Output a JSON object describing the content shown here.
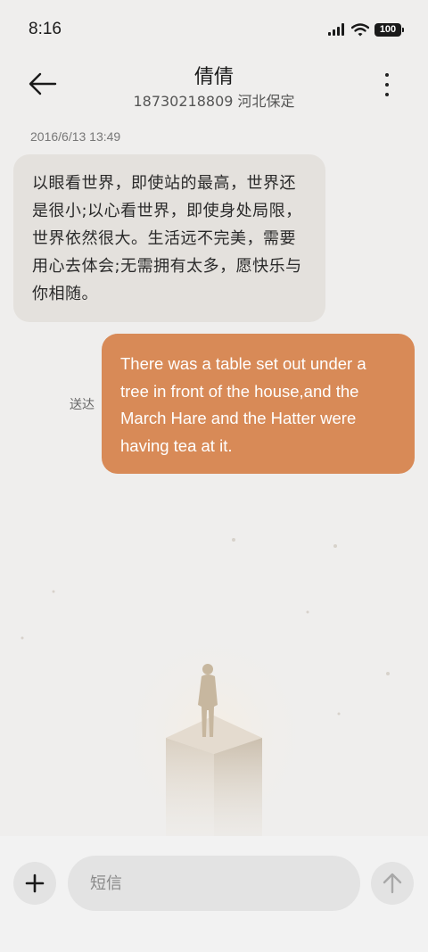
{
  "status_bar": {
    "time": "8:16",
    "battery": "100",
    "icons": [
      "signal-icon",
      "wifi-icon",
      "battery-icon"
    ]
  },
  "header": {
    "contact_name": "倩倩",
    "contact_sub": "18730218809 河北保定",
    "back_icon": "arrow-left-icon",
    "more_icon": "more-vertical-icon"
  },
  "messages": {
    "timestamp": "2016/6/13 13:49",
    "incoming_text": "以眼看世界，即使站的最高，世界还是很小;以心看世界，即使身处局限，世界依然很大。生活远不完美，需要用心去体会;无需拥有太多，愿快乐与你相随。",
    "outgoing_text": "There was a table set out under a tree in front of the house,and the March Hare and the Hatter were having tea at it.",
    "outgoing_status": "送达"
  },
  "composer": {
    "placeholder": "短信",
    "add_icon": "plus-icon",
    "send_icon": "arrow-up-icon"
  },
  "colors": {
    "background": "#efeeed",
    "incoming_bubble": "#e4e1dd",
    "outgoing_bubble": "#d88a57",
    "composer_bg": "#e3e3e3"
  }
}
